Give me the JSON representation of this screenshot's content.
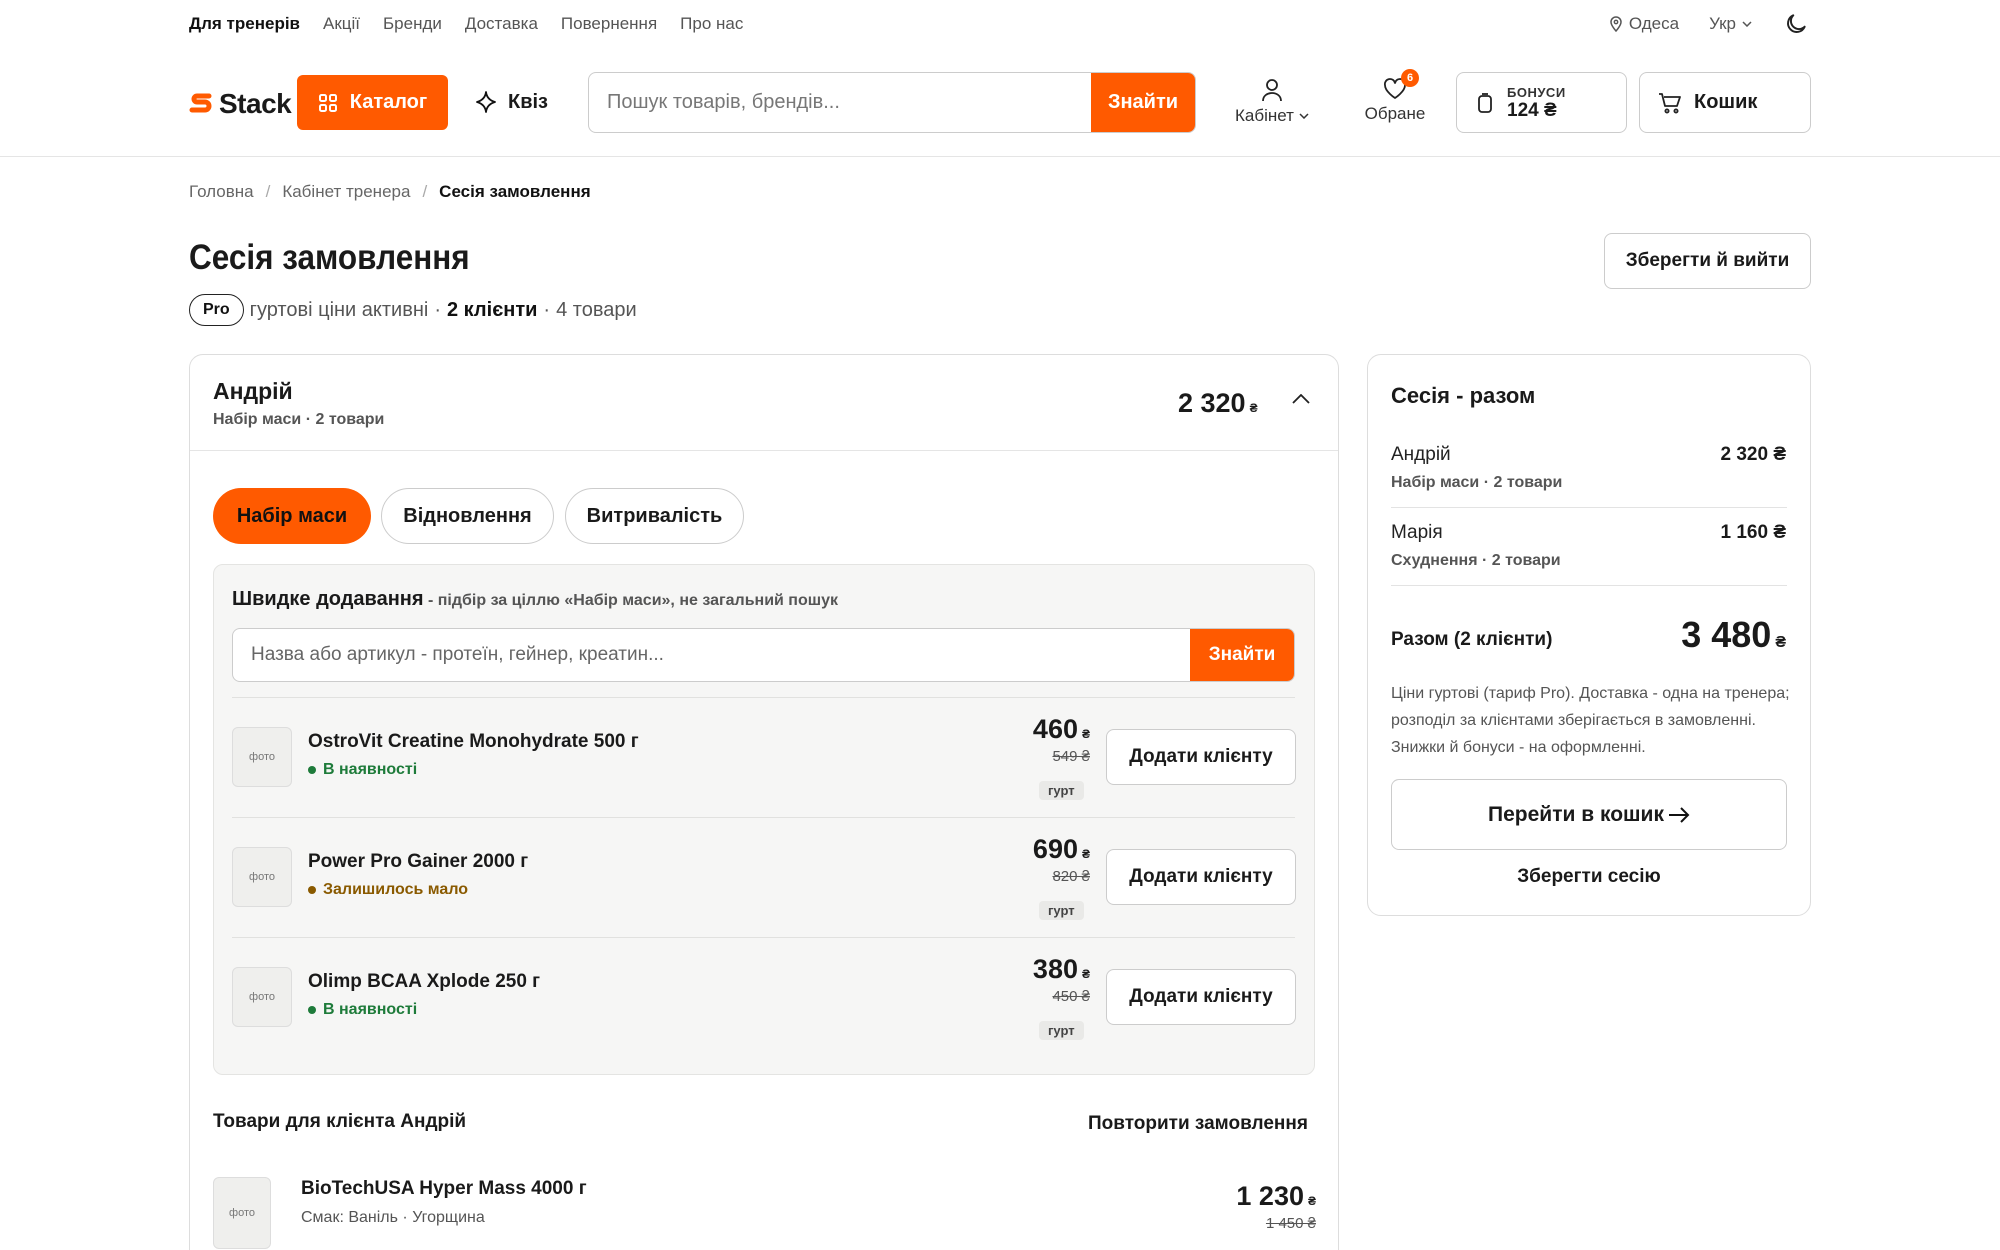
{
  "topnav": {
    "items": [
      "Для тренерів",
      "Акції",
      "Бренди",
      "Доставка",
      "Повернення",
      "Про нас"
    ],
    "city": "Одеса",
    "lang": "Укр"
  },
  "header": {
    "logo": "Stack",
    "catalog": "Каталог",
    "quiz": "Квіз",
    "search_placeholder": "Пошук товарів, брендів...",
    "search_button": "Знайти",
    "cabinet": "Кабінет",
    "favorites": "Обране",
    "favorites_count": "6",
    "bonus_label": "БОНУСИ",
    "bonus_value": "124 ₴",
    "cart": "Кошик",
    "accent": "#ff5a00"
  },
  "breadcrumb": [
    "Головна",
    "Кабінет тренера",
    "Сесія замовлення"
  ],
  "page": {
    "title": "Сесія замовлення",
    "save_exit": "Зберегти й вийти",
    "pro": "Pro",
    "prices_active": "гуртові ціни активні",
    "sep": "·",
    "clients": "2 клієнти",
    "goods": "4 товари"
  },
  "client": {
    "name": "Андрій",
    "sub": "Набір маси · 2 товари",
    "sum": "2 320",
    "currency": "₴",
    "goals": [
      "Набір маси",
      "Відновлення",
      "Витривалість"
    ],
    "quick_title": "Швидке додавання",
    "quick_hint": " - підбір за ціллю «Набір маси», не загальний пошук",
    "quick_placeholder": "Назва або артикул - протеїн, гейнер, креатин...",
    "quick_button": "Знайти",
    "thumb_label": "фото",
    "add_label": "Додати клієнту",
    "gurt": "гурт",
    "products": [
      {
        "name": "OstroVit Creatine Monohydrate 500 г",
        "stock": "В наявності",
        "price": "460",
        "old": "549 ₴"
      },
      {
        "name": "Power Pro Gainer 2000 г",
        "stock": "Залишилось мало",
        "price": "690",
        "old": "820 ₴"
      },
      {
        "name": "Olimp BCAA Xplode 250 г",
        "stock": "В наявності",
        "price": "380",
        "old": "450 ₴"
      }
    ],
    "items_title": "Товари для клієнта Андрій",
    "repeat": "Повторити замовлення",
    "item": {
      "name": "BioTechUSA Hyper Mass 4000 г",
      "sub": "Смак: Ваніль · Угорщина",
      "price": "1 230",
      "old": "1 450 ₴"
    }
  },
  "summary": {
    "title": "Сесія - разом",
    "rows": [
      {
        "name": "Андрій",
        "sub": "Набір маси · 2 товари",
        "value": "2 320 ₴"
      },
      {
        "name": "Марія",
        "sub": "Схуднення · 2 товари",
        "value": "1 160 ₴"
      }
    ],
    "total_label": "Разом (2 клієнти)",
    "total_value": "3 480",
    "note": "Ціни гуртові (тариф Pro). Доставка - одна на тренера; розподіл за клієнтами зберігається в замовленні. Знижки й бонуси - на оформленні.",
    "go_cart": "Перейти в кошик",
    "save_session": "Зберегти сесію"
  }
}
